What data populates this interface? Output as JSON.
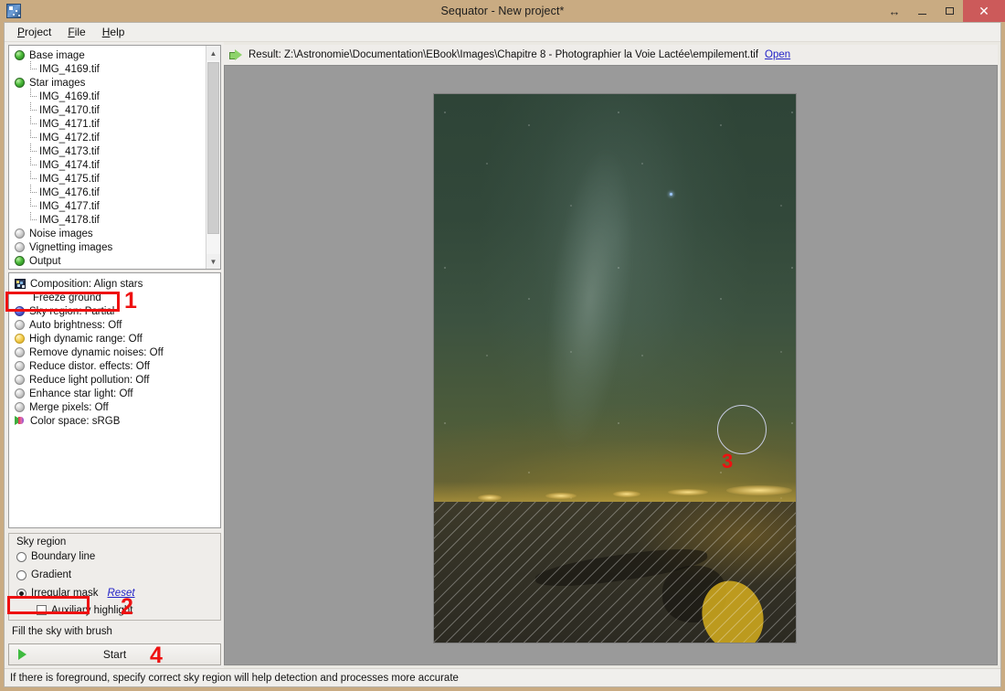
{
  "window": {
    "title": "Sequator - New project*",
    "app_icon": "sequator-app-icon",
    "buttons": {
      "resize": "↔",
      "minimize": "minimize",
      "maximize": "maximize",
      "close": "✕"
    }
  },
  "menubar": {
    "items": [
      {
        "label": "Project",
        "accel": "P"
      },
      {
        "label": "File",
        "accel": "F"
      },
      {
        "label": "Help",
        "accel": "H"
      }
    ]
  },
  "tree": {
    "nodes": [
      {
        "label": "Base image",
        "state": "green",
        "children": [
          "IMG_4169.tif"
        ]
      },
      {
        "label": "Star images",
        "state": "green",
        "children": [
          "IMG_4169.tif",
          "IMG_4170.tif",
          "IMG_4171.tif",
          "IMG_4172.tif",
          "IMG_4173.tif",
          "IMG_4174.tif",
          "IMG_4175.tif",
          "IMG_4176.tif",
          "IMG_4177.tif",
          "IMG_4178.tif"
        ]
      },
      {
        "label": "Noise images",
        "state": "gray",
        "children": []
      },
      {
        "label": "Vignetting images",
        "state": "gray",
        "children": []
      },
      {
        "label": "Output",
        "state": "green",
        "children": []
      }
    ],
    "scroll_up": "▲",
    "scroll_down": "▼"
  },
  "options": {
    "items": [
      {
        "label": "Composition: Align stars",
        "icon": "composition-icon",
        "sub": false
      },
      {
        "label": "Freeze ground",
        "icon": "none",
        "sub": true
      },
      {
        "label": "Sky region: Partial",
        "icon": "blue-sphere",
        "sub": false
      },
      {
        "label": "Auto brightness: Off",
        "icon": "gray-sphere",
        "sub": false
      },
      {
        "label": "High dynamic range: Off",
        "icon": "yellow-sphere",
        "sub": false
      },
      {
        "label": "Remove dynamic noises: Off",
        "icon": "gray-sphere",
        "sub": false
      },
      {
        "label": "Reduce distor. effects: Off",
        "icon": "gray-sphere",
        "sub": false
      },
      {
        "label": "Reduce light pollution: Off",
        "icon": "gray-sphere",
        "sub": false
      },
      {
        "label": "Enhance star light: Off",
        "icon": "gray-sphere",
        "sub": false
      },
      {
        "label": "Merge pixels: Off",
        "icon": "gray-sphere",
        "sub": false
      },
      {
        "label": "Color space: sRGB",
        "icon": "colorspace-icon",
        "sub": false
      }
    ]
  },
  "sky_region": {
    "group_title": "Sky region",
    "radios": [
      {
        "label": "Boundary line",
        "checked": false
      },
      {
        "label": "Gradient",
        "checked": false
      },
      {
        "label": "Irregular mask",
        "checked": true
      }
    ],
    "reset_link": "Reset",
    "auxiliary_checkbox": {
      "label": "Auxiliary highlight",
      "checked": false
    },
    "brush_hint": "Fill the sky with brush"
  },
  "start": {
    "label": "Start"
  },
  "result": {
    "prefix": "Result:",
    "path": "Z:\\Astronomie\\Documentation\\EBook\\Images\\Chapitre 8 - Photographier la Voie Lactée\\empilement.tif",
    "full": "Result: Z:\\Astronomie\\Documentation\\EBook\\Images\\Chapitre 8 - Photographier la Voie Lactée\\empilement.tif",
    "open_link": "Open"
  },
  "annotations": [
    {
      "id": "1",
      "label": "1",
      "target": "sky-region-option"
    },
    {
      "id": "2",
      "label": "2",
      "target": "irregular-mask-radio"
    },
    {
      "id": "3",
      "label": "3",
      "target": "brush-cursor-on-canvas"
    },
    {
      "id": "4",
      "label": "4",
      "target": "start-button"
    }
  ],
  "statusbar": {
    "text": "If there is foreground, specify correct sky region will help detection and processes more accurate"
  },
  "colors": {
    "titlebar": "#c9ab82",
    "close_button": "#cc5a5a",
    "annotation_red": "#ee1111",
    "link_blue": "#2323c8",
    "canvas_bg": "#9a9a9a",
    "mask_yellow": "#d0aa1e"
  }
}
